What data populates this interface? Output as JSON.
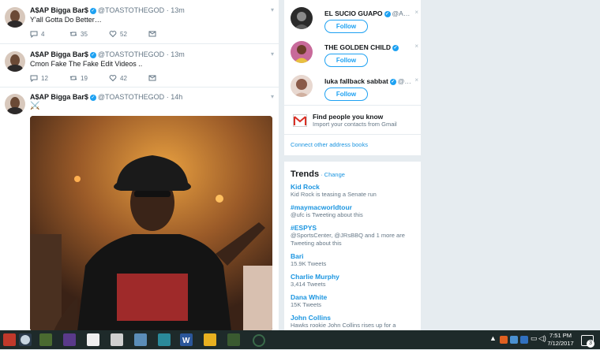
{
  "feed": {
    "tweets": [
      {
        "name": "A$AP Bigga Bar$",
        "handle": "@TOASTOTHEGOD",
        "time": "13m",
        "text": "Y'all Gotta Do Better…",
        "replies": "4",
        "retweets": "35",
        "likes": "52"
      },
      {
        "name": "A$AP Bigga Bar$",
        "handle": "@TOASTOTHEGOD",
        "time": "13m",
        "text": "Cmon Fake The Fake Edit Videos ..",
        "replies": "12",
        "retweets": "19",
        "likes": "42"
      },
      {
        "name": "A$AP Bigga Bar$",
        "handle": "@TOASTOTHEGOD",
        "time": "14h",
        "text": "⚔️"
      }
    ]
  },
  "who_to_follow": {
    "accounts": [
      {
        "name": "EL SUCIO GUAPO",
        "handle": "@A…",
        "follow_label": "Follow",
        "close": "×"
      },
      {
        "name": "THE GOLDEN CHILD",
        "handle": "",
        "follow_label": "Follow",
        "close": "×"
      },
      {
        "name": "luka fallback sabbat",
        "handle": "@…",
        "follow_label": "Follow",
        "close": "×"
      }
    ],
    "find_people": {
      "title": "Find people you know",
      "subtitle": "Import your contacts from Gmail"
    },
    "connect_link": "Connect other address books"
  },
  "trends": {
    "title": "Trends",
    "change": "· Change",
    "items": [
      {
        "name": "Kid Rock",
        "desc": "Kid Rock is teasing a Senate run"
      },
      {
        "name": "#maymacworldtour",
        "desc": "@ufc is Tweeting about this"
      },
      {
        "name": "#ESPYS",
        "desc": "@SportsCenter, @JRsBBQ and 1 more are Tweeting about this"
      },
      {
        "name": "Bari",
        "desc": "15.9K Tweets"
      },
      {
        "name": "Charlie Murphy",
        "desc": "3,414 Tweets"
      },
      {
        "name": "Dana White",
        "desc": "15K Tweets"
      },
      {
        "name": "John Collins",
        "desc": "Hawks rookie John Collins rises up for a"
      }
    ]
  },
  "taskbar": {
    "time": "7:51 PM",
    "date": "7/12/2017",
    "notifications": "3",
    "colors": {
      "bar": "#1e2a2a",
      "accent": "#1da1f2"
    }
  }
}
